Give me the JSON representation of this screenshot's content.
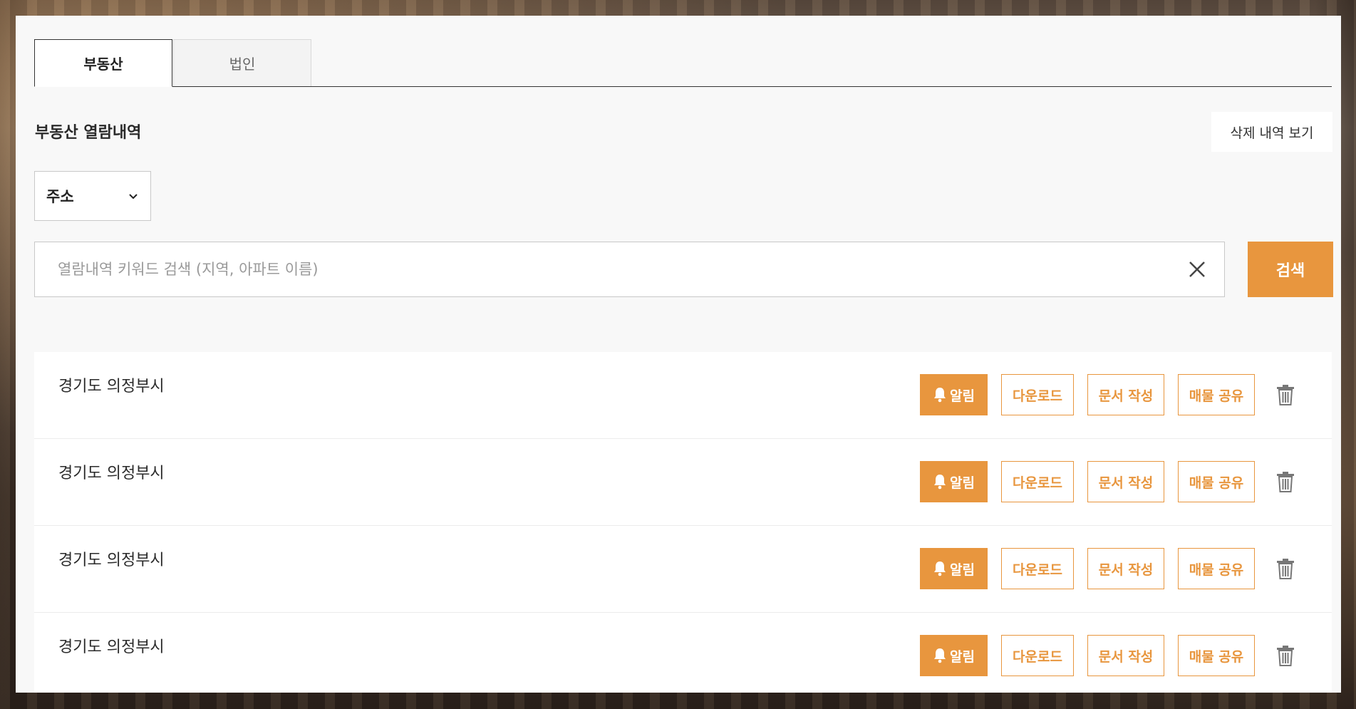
{
  "tabs": [
    {
      "label": "부동산",
      "active": true
    },
    {
      "label": "법인",
      "active": false
    }
  ],
  "section": {
    "title": "부동산 열람내역",
    "deleted_view_label": "삭제 내역 보기"
  },
  "filter": {
    "selected": "주소"
  },
  "search": {
    "value": "",
    "placeholder": "열람내역 키워드 검색 (지역, 아파트 이름)",
    "button_label": "검색"
  },
  "actions": {
    "alarm": "알림",
    "download": "다운로드",
    "write_doc": "문서 작성",
    "share": "매물 공유"
  },
  "records": [
    {
      "title": "경기도 의정부시"
    },
    {
      "title": "경기도 의정부시"
    },
    {
      "title": "경기도 의정부시"
    },
    {
      "title": "경기도 의정부시"
    }
  ],
  "colors": {
    "accent": "#e8963e",
    "panel_bg": "#f8f8f8"
  }
}
